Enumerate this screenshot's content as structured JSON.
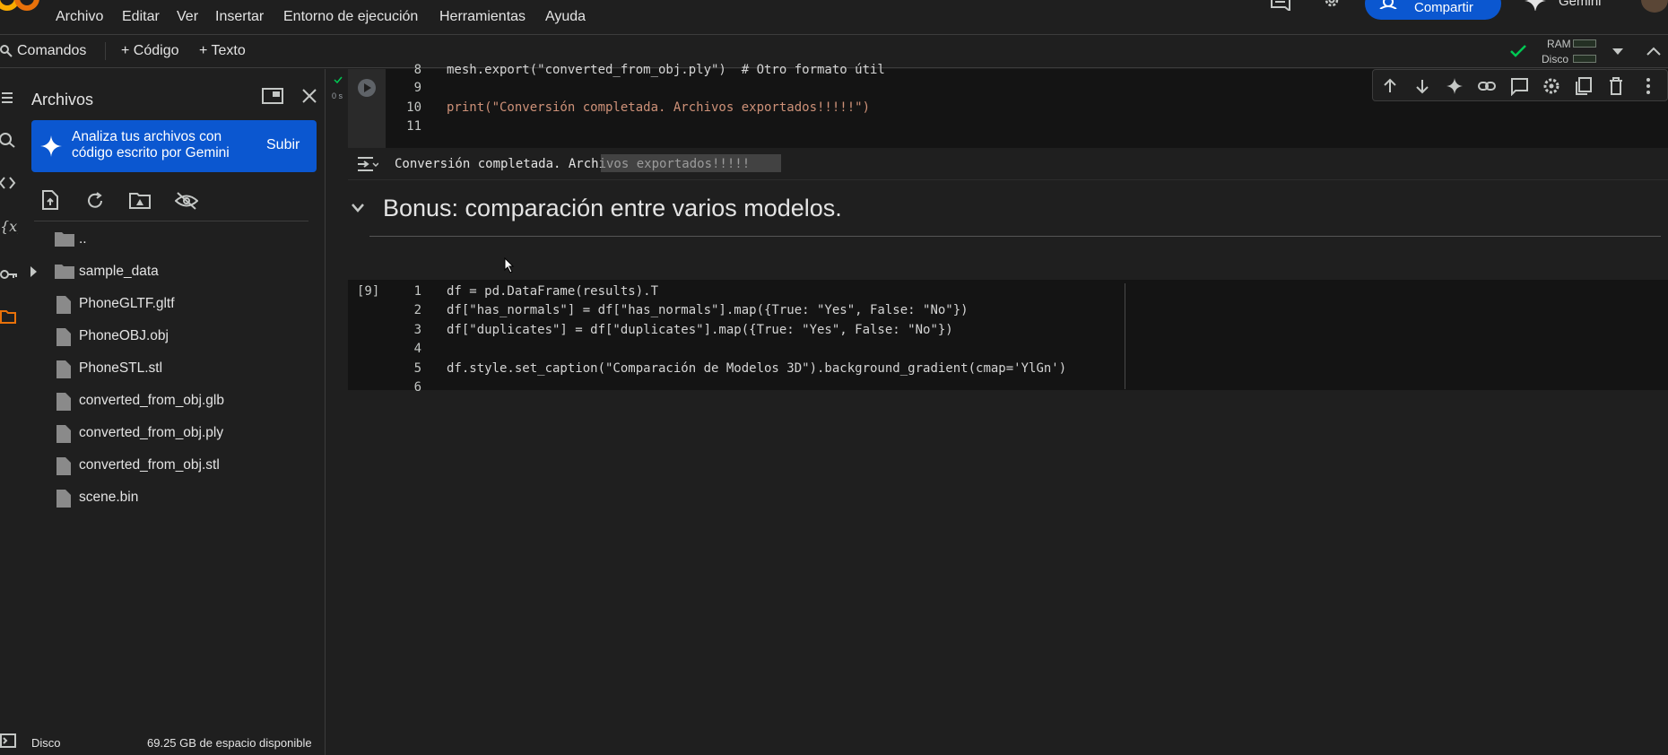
{
  "menu": {
    "items": [
      "Archivo",
      "Editar",
      "Ver",
      "Insertar",
      "Entorno de ejecución",
      "Herramientas",
      "Ayuda"
    ],
    "share_label": "Compartir",
    "gemini_label": "Gemini"
  },
  "toolbar": {
    "commands_label": "Comandos",
    "add_code_label": "+ Código",
    "add_text_label": "+ Texto",
    "ram_label": "RAM",
    "disk_label": "Disco"
  },
  "files_panel": {
    "title": "Archivos",
    "banner_text": "Analiza tus archivos con código escrito por Gemini",
    "banner_button": "Subir",
    "items": [
      {
        "name": "..",
        "type": "folder"
      },
      {
        "name": "sample_data",
        "type": "folder"
      },
      {
        "name": "PhoneGLTF.gltf",
        "type": "file"
      },
      {
        "name": "PhoneOBJ.obj",
        "type": "file"
      },
      {
        "name": "PhoneSTL.stl",
        "type": "file"
      },
      {
        "name": "converted_from_obj.glb",
        "type": "file"
      },
      {
        "name": "converted_from_obj.ply",
        "type": "file"
      },
      {
        "name": "converted_from_obj.stl",
        "type": "file"
      },
      {
        "name": "scene.bin",
        "type": "file"
      }
    ],
    "disk_label": "Disco",
    "disk_space": "69.25 GB de espacio disponible"
  },
  "cell1": {
    "exec_time": "0 s",
    "line_numbers": [
      "8",
      "9",
      "10",
      "11"
    ],
    "lines": [
      "mesh.export(\"converted_from_obj.ply\")  # Otro formato útil",
      "",
      "print(\"Conversión completada. Archivos exportados!!!!!\")",
      ""
    ],
    "output": "Conversión completada. Archivos exportados!!!!!"
  },
  "section": {
    "heading": "Bonus: comparación entre varios modelos."
  },
  "cell2": {
    "exec_count": "[9]",
    "line_numbers": [
      "1",
      "2",
      "3",
      "4",
      "5",
      "6"
    ],
    "lines": [
      "df = pd.DataFrame(results).T",
      "df[\"has_normals\"] = df[\"has_normals\"].map({True: \"Yes\", False: \"No\"})",
      "df[\"duplicates\"] = df[\"duplicates\"].map({True: \"Yes\", False: \"No\"})",
      "",
      "df.style.set_caption(\"Comparación de Modelos 3D\").background_gradient(cmap='YlGn')",
      ""
    ]
  },
  "colors": {
    "accent_blue": "#0b57d0",
    "background": "#1f1f1f",
    "code_background": "#141414",
    "run_ok_green": "#00c853"
  }
}
